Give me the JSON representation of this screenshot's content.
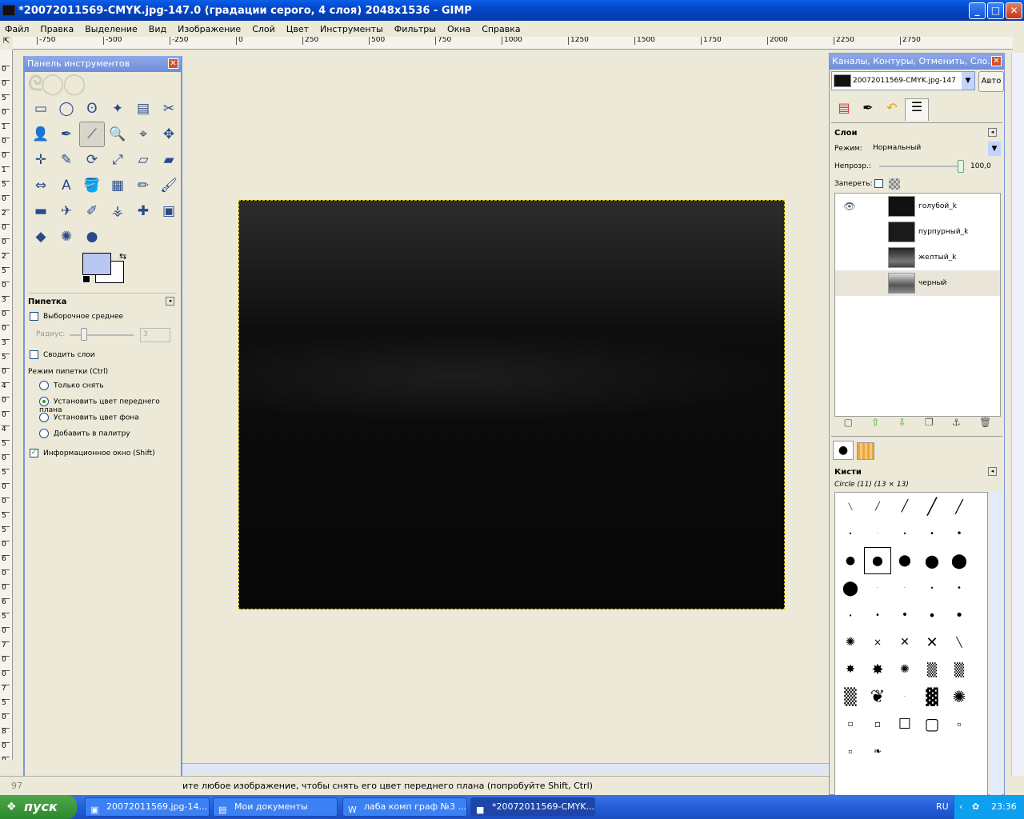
{
  "window": {
    "title": "*20072011569-CMYK.jpg-147.0 (градации серого, 4 слоя) 2048x1536 - GIMP",
    "minimize": "_",
    "maximize": "□",
    "close": "✕"
  },
  "menu": [
    "Файл",
    "Правка",
    "Выделение",
    "Вид",
    "Изображение",
    "Слой",
    "Цвет",
    "Инструменты",
    "Фильтры",
    "Окна",
    "Справка"
  ],
  "hruler": [
    "-750",
    "-500",
    "-250",
    "0",
    "250",
    "500",
    "750",
    "1000",
    "1250",
    "1500",
    "1750",
    "2000",
    "2250",
    "2750"
  ],
  "vruler": [
    "0",
    "0",
    "5",
    "0",
    "1",
    "0",
    "0",
    "1",
    "5",
    "0",
    "2",
    "0",
    "0",
    "2",
    "5",
    "0",
    "3",
    "0",
    "0",
    "3",
    "5",
    "0",
    "4",
    "0",
    "0",
    "4",
    "5",
    "0",
    "5",
    "0",
    "0",
    "5",
    "5",
    "0",
    "6",
    "0",
    "0",
    "6",
    "5",
    "0",
    "7",
    "0",
    "0",
    "7",
    "5",
    "0",
    "8",
    "0",
    "0"
  ],
  "toolbox": {
    "title": "Панель инструментов",
    "close": "✕",
    "tools": [
      "rect-select",
      "ellipse-select",
      "free-select",
      "fuzzy-select",
      "color-select",
      "scissors",
      "foreground-select",
      "paths",
      "color-picker",
      "zoom",
      "measure",
      "move",
      "align",
      "crop",
      "rotate",
      "scale",
      "shear",
      "perspective",
      "flip",
      "text",
      "bucket-fill",
      "blend",
      "pencil",
      "paintbrush",
      "eraser",
      "airbrush",
      "ink",
      "clone",
      "heal",
      "perspective-clone",
      "smudge",
      "convolve",
      "dodge-burn"
    ],
    "tool_glyphs": [
      "▭",
      "◯",
      "ʘ",
      "✦",
      "▤",
      "✂",
      "👤",
      "✒",
      "⟋",
      "🔍",
      "⌖",
      "✥",
      "✛",
      "✎",
      "⟳",
      "⤢",
      "▱",
      "▰",
      "⇔",
      "A",
      "🪣",
      "▦",
      "✏",
      "🖌",
      "▬",
      "✈",
      "✐",
      "⚶",
      "✚",
      "▣",
      "◆",
      "✺",
      "●"
    ],
    "colors": {
      "fg": "#b8c8f0",
      "bg": "#ffffff"
    },
    "picker": {
      "heading": "Пипетка",
      "sample_average": "Выборочное среднее",
      "radius_label": "Радиус:",
      "radius_value": "3",
      "sample_merged": "Сводить слои",
      "mode_label": "Режим пипетки (Ctrl)",
      "modes": [
        "Только снять",
        "Установить цвет переднего плана",
        "Установить цвет фона",
        "Добавить в палитру"
      ],
      "selected_mode": 1,
      "info_window": "Информационное окно (Shift)"
    }
  },
  "rightdock": {
    "title": "Каналы, Контуры, Отменить, Сло...",
    "close": "✕",
    "image_select": "20072011569-CMYK.jpg-147",
    "auto_button": "Авто",
    "layers": {
      "heading": "Слои",
      "mode_label": "Режим:",
      "mode_value": "Нормальный",
      "opacity_label": "Непрозр.:",
      "opacity_value": "100,0",
      "lock_label": "Запереть:",
      "items": [
        {
          "name": "голубой_k",
          "visible": true
        },
        {
          "name": "пурпурный_k",
          "visible": false
        },
        {
          "name": "желтый_k",
          "visible": false
        },
        {
          "name": "черный",
          "visible": false
        }
      ]
    },
    "brushes": {
      "heading": "Кисти",
      "current": "Circle (11) (13 × 13)"
    }
  },
  "status": {
    "zoom": "97",
    "message": "ите любое изображение, чтобы снять его цвет переднего плана (попробуйте Shift, Ctrl)"
  },
  "taskbar": {
    "start": "пуск",
    "tasks": [
      "20072011569.jpg-14...",
      "Мои документы",
      "лаба комп граф №3 ...",
      "*20072011569-CMYK...."
    ],
    "lang": "RU",
    "time": "23:36"
  }
}
